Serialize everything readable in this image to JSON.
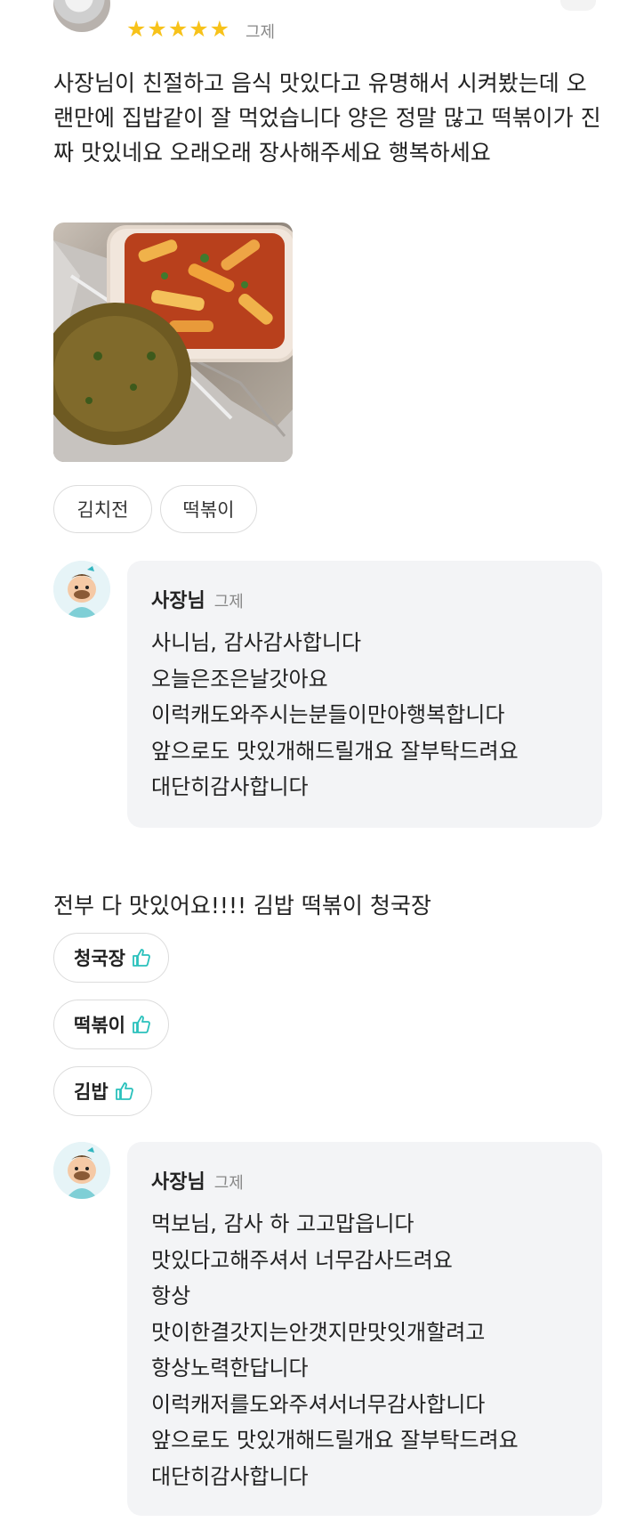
{
  "review1": {
    "stars": "★★★★★",
    "date": "그제",
    "text": "사장님이 친절하고 음식 맛있다고 유명해서 시켜봤는데 오랜만에 집밥같이 잘 먹었습니다 양은 정말 많고 떡볶이가 진짜 맛있네요 오래오래 장사해주세요 행복하세요",
    "tags": [
      "김치전",
      "떡볶이"
    ]
  },
  "reply1": {
    "name": "사장님",
    "date": "그제",
    "text": "사니님, 감사감사합니다\n오늘은조은날갓아요\n이럭캐도와주시는분들이만아행복합니다\n앞으로도 맛있개해드릴개요 잘부탁드려요\n대단히감사합니다"
  },
  "review2": {
    "text": "전부 다 맛있어요!!!! 김밥 떡볶이 청국장",
    "liked_menus": [
      "청국장",
      "떡볶이",
      "김밥"
    ]
  },
  "reply2": {
    "name": "사장님",
    "date": "그제",
    "text": "먹보님, 감사 하 고고맙읍니다\n맛있다고해주셔서 너무감사드려요\n항상\n맛이한결갓지는안갯지만맛잇개할려고\n항상노력한답니다\n이럭캐저를도와주셔서너무감사합니다\n앞으로도 맛있개해드릴개요 잘부탁드려요\n 대단히감사합니다"
  },
  "icons": {
    "thumb": "thumbs-up-icon",
    "star": "star-icon"
  },
  "colors": {
    "star": "#f7c21a",
    "thumb": "#2ac1bc",
    "bubble": "#f3f4f6"
  }
}
